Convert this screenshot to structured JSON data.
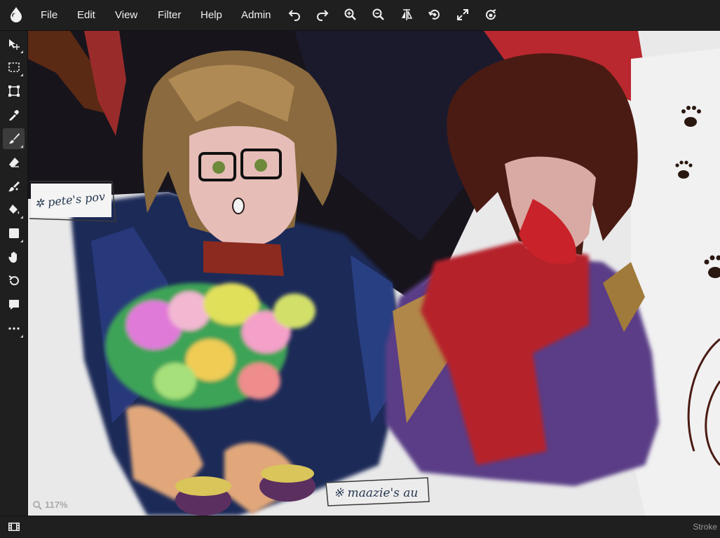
{
  "menu": {
    "file": "File",
    "edit": "Edit",
    "view": "View",
    "filter": "Filter",
    "help": "Help",
    "admin": "Admin"
  },
  "toolbar_icons": [
    "undo-icon",
    "redo-icon",
    "zoom-in-icon",
    "zoom-out-icon",
    "flip-icon",
    "rotate-icon",
    "fullscreen-icon",
    "reset-rotation-icon"
  ],
  "tools": [
    "move-tool",
    "select-tool",
    "transform-tool",
    "pipette-tool",
    "brush-tool",
    "eraser-tool",
    "smudge-tool",
    "fill-tool",
    "shape-tool",
    "hand-tool",
    "rotate-tool",
    "comment-tool",
    "more-tools"
  ],
  "canvas": {
    "zoom": "117%",
    "notes": {
      "left": "✲ pete's pov",
      "bottom": "※ maazie's au"
    }
  },
  "status": {
    "stroke_label": "Stroke"
  },
  "colors": {
    "bar_bg": "#1f1f1f",
    "active_tool_bg": "#3c3c3c",
    "canvas_bg": "#e9e9ea"
  }
}
